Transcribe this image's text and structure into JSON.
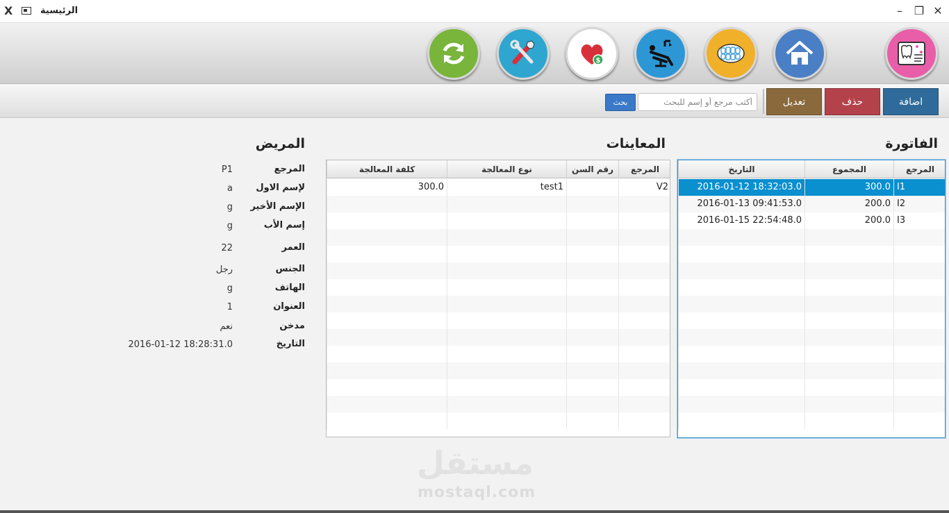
{
  "window": {
    "title": "الرئيسية",
    "controls": {
      "minimize": "–",
      "restore": "❐",
      "close": "✕"
    },
    "app_icon": "X"
  },
  "toolbar_icons": [
    {
      "name": "app-logo-icon",
      "color": "#e85ea8"
    },
    {
      "name": "home-icon",
      "color": "#4a7fc5"
    },
    {
      "name": "teeth-icon",
      "color": "#f0b02a"
    },
    {
      "name": "dental-chair-icon",
      "color": "#2d97d6"
    },
    {
      "name": "heart-payment-icon",
      "color": "#ffffff"
    },
    {
      "name": "tools-icon",
      "color": "#2ea6cf"
    },
    {
      "name": "refresh-icon",
      "color": "#79b43b"
    }
  ],
  "actions": {
    "add": "اضافة",
    "delete": "حذف",
    "edit": "تعديل",
    "search_placeholder": "أكتب مرجع أو إسم للبحث",
    "search_value": "",
    "search_button": "بحث",
    "colors": {
      "add": "#2f6b9a",
      "delete": "#b4424a",
      "edit": "#8a6a3c",
      "search": "#3a79c9"
    }
  },
  "invoice": {
    "title": "الفاتورة",
    "columns": [
      "المرجع",
      "المجموع",
      "التاريخ"
    ],
    "rows": [
      {
        "ref": "I1",
        "total": "300.0",
        "date": "2016-01-12 18:32:03.0"
      },
      {
        "ref": "I2",
        "total": "200.0",
        "date": "2016-01-13 09:41:53.0"
      },
      {
        "ref": "I3",
        "total": "200.0",
        "date": "2016-01-15 22:54:48.0"
      }
    ],
    "selected_row": 0
  },
  "exams": {
    "title": "المعاينات",
    "columns": [
      "المرجع",
      "رقم السن",
      "نوع المعالجة",
      "كلفة المعالجة"
    ],
    "rows": [
      {
        "ref": "V2",
        "tooth": "",
        "type": "test1",
        "cost": "300.0"
      }
    ]
  },
  "patient": {
    "title": "المريض",
    "fields": [
      {
        "label": "المرجع",
        "value": "P1"
      },
      {
        "label": "لإسم الاول",
        "value": "a"
      },
      {
        "label": "الإسم الأخير",
        "value": "g"
      },
      {
        "label": "إسم الأب",
        "value": "g"
      },
      {
        "label": "العمر",
        "value": "22"
      },
      {
        "label": "الجنس",
        "value": "رجل"
      },
      {
        "label": "الهاتف",
        "value": "g"
      },
      {
        "label": "العنوان",
        "value": "1"
      },
      {
        "label": "مدخن",
        "value": "نعم"
      },
      {
        "label": "التاريخ",
        "value": "2016-01-12 18:28:31.0"
      }
    ]
  },
  "watermark": {
    "arabic": "مستقل",
    "latin": "mostaql.com"
  }
}
